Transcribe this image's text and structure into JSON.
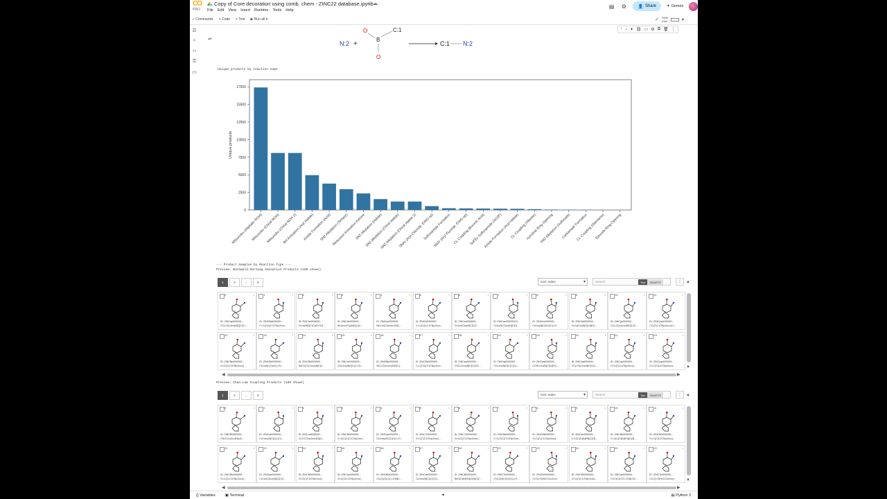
{
  "header": {
    "logo_text": "CO",
    "pro_text": "PRO",
    "title": "Copy of Core decoration using comb. chem - ZINC22 database.ipynb",
    "menus": [
      "File",
      "Edit",
      "View",
      "Insert",
      "Runtime",
      "Tools",
      "Help"
    ],
    "share_label": "Share",
    "gemini_label": "Gemini"
  },
  "toolbar": {
    "commands_label": "Commands",
    "code_label": "+ Code",
    "text_label": "+ Text",
    "run_all_label": "Run all",
    "ram_label": "RAM",
    "disk_label": "Disk"
  },
  "reaction": {
    "left_n": "N:2",
    "plus": "+",
    "o_top": "O",
    "c1_top": "C:1",
    "b": "B",
    "o_bottom": "O",
    "prod_c": "C:1",
    "prod_n": "N:2"
  },
  "text": {
    "chart_caption": "Unique products by reaction name",
    "samples_header": "--- Product Samples by Reaction Type ---",
    "preview1": "Preview: Buchwald-Hartwig Amination Products (100 shown)",
    "preview2": "Preview: Chan-Lam Coupling Products (100 shown)"
  },
  "chart_data": {
    "type": "bar",
    "ylabel": "Unique products",
    "xlabel": "",
    "ylim": [
      0,
      18500
    ],
    "yticks": [
      0,
      2500,
      5000,
      7500,
      10000,
      12500,
      15000,
      17500
    ],
    "color": "#3274a1",
    "categories": [
      "Mitsunobu (Aliphatic ROH)",
      "Mitsunobu (Chiral ROH)",
      "Mitsunobu (Chiral ROH 2)",
      "BH Amination (Aryl Halide)",
      "Amide Formation (Acid)",
      "SN2 Alkylation (Tertiary)",
      "Reductive Amination Ketone",
      "SN2 Alkylation (Halide)",
      "SN2 Alkylation (Chiral Halide)",
      "SN2 Alkylation (Chiral Halide 2)",
      "SNAr (Aryl Chloride, EWG-sp)",
      "Sulfonamide Formation",
      "SNAr (Aryl Fluoride, EWG-sp)",
      "CL Coupling (Boronic Acid)",
      "SuFEx Sulfonamide (SO2F)",
      "Amide Formation (Acyl Halide)",
      "CL Coupling (Silanes)",
      "Aziridine Ring Opening",
      "SN2 Alkylation (Sulfonate)",
      "Carbamate Formation",
      "CL Coupling (Stannane)",
      "Epoxide Ring Opening"
    ],
    "values": [
      17400,
      8100,
      8100,
      4950,
      3750,
      2950,
      2350,
      1550,
      1200,
      1200,
      550,
      250,
      230,
      210,
      190,
      170,
      120,
      60,
      50,
      30,
      20,
      10
    ]
  },
  "grid1": {
    "pages": [
      "1",
      "2",
      "...",
      "5"
    ],
    "sort_label": "Sort: Index",
    "search_placeholder": "Search",
    "toggle_text": "Text",
    "toggle_smarts": "SMARTS",
    "cards": [
      {
        "n": "0",
        "t1": "ID: ZINCapl000001...",
        "t2": "CC(=O)c1cc(N[C]C(C=..."
      },
      {
        "n": "1",
        "t1": "ID: ZINCBbl000000...",
        "t2": "C=C(C)C(C1CN(c2ccc..."
      },
      {
        "n": "2",
        "t1": "ID: ZINCaeI000000...",
        "t2": "Cc1c(N[C]C(C)c2=O(1..."
      },
      {
        "n": "3",
        "t1": "ID: ZINCbkI000000...",
        "t2": "Nc1ncccF)c(N[C]C(C..."
      },
      {
        "n": "4",
        "t1": "ID: ZINCaoI000000...",
        "t2": "NCc1c(Cl)ccc(c1N(C..."
      },
      {
        "n": "5",
        "t1": "ID: ZINCb0000000...",
        "t2": "C=C(C)C(C1CN(c2ccc..."
      },
      {
        "n": "6",
        "t1": "ID: ZINCsaI000000...",
        "t2": "Cc1cc(Cl)c(N[C]C(C..."
      },
      {
        "n": "7",
        "t1": "ID: ZINCaeI00000024",
        "t2": "Cc1c(NCC)cc(N[C]C(..."
      },
      {
        "n": "8",
        "t1": "ID: ZINCboI000000...",
        "t2": "Cc1cc(N[C]C(C)C(=O..."
      },
      {
        "n": "9",
        "t1": "ID: ZINCb6I000000...",
        "t2": "Cc1c(C)c(N[C]C@H(..."
      },
      {
        "n": "10",
        "t1": "ID: ZINC(pl000000...",
        "t2": "CC(=O)c1ccc(N[C]C(C..."
      },
      {
        "n": "11",
        "t1": "ID: ZINC(aeI000000...",
        "t2": "CC(C)C1CN(c2ccc(C=..."
      },
      {
        "n": "12",
        "t1": "ID: ZINCBpI000000...",
        "t2": "O=C(C)C1CN(c2ccc(..."
      },
      {
        "n": "13",
        "t1": "ID: ZINCBkI000000...",
        "t2": "Cc1c(NCC)c(C(=O)..."
      },
      {
        "n": "14",
        "t1": "ID: ZINCBhI000000...",
        "t2": "N#CC(C)c1ccc(N[C]C..."
      },
      {
        "n": "15",
        "t1": "ID: ZINCaGI000000...",
        "t2": "COc1cc(N[C]C(C=O)..."
      },
      {
        "n": "16",
        "t1": "ID: ZINCBkI000000...",
        "t2": "NC(=O)c1ccc(N[C]C(..."
      },
      {
        "n": "17",
        "t1": "ID: ZINCBpI000000...",
        "t2": "C=C(C)C(C1CN(c2ccc..."
      },
      {
        "n": "18",
        "t1": "ID: ZINCapI000000...",
        "t2": "CSCc1ccc(N[C]C(C)C..."
      },
      {
        "n": "19",
        "t1": "ID: ZINCapI000000...",
        "t2": "CCc1cc(N[C]C(C)C(=..."
      },
      {
        "n": "20",
        "t1": "ID: ZINCaaI000000...",
        "t2": "CCNCc1c(N[C]C@H(..."
      },
      {
        "n": "21",
        "t1": "ID: ZINCaaI000000...",
        "t2": "CC(=O)c1cc(N[C]C(C..."
      },
      {
        "n": "22",
        "t1": "ID: ZINCapI000000...",
        "t2": "O=C(C)C1CN(c2ccc(..."
      },
      {
        "n": "23",
        "t1": "ID: ZINC(apI000000...",
        "t2": "O=C(C)C1CN(c2ccc(..."
      }
    ]
  },
  "grid2": {
    "pages": [
      "1",
      "2",
      "...",
      "5"
    ],
    "sort_label": "Sort: Index",
    "search_placeholder": "Search",
    "toggle_text": "Text",
    "toggle_smarts": "SMARTS",
    "cards": [
      {
        "n": "0",
        "t1": "ID: ZINCB0000000...",
        "t2": "CN1CC(c2cc(N)c(C..."
      },
      {
        "n": "1",
        "t1": "ID: ZINCaeI000000...",
        "t2": "Cc1ncc(N[C]C(C)C(..."
      },
      {
        "n": "2",
        "t1": "ID: ZINCaaI000000...",
        "t2": "CC1CCN(c2ccc(N[C]..."
      },
      {
        "n": "3",
        "t1": "ID: ZINCB0000000...",
        "t2": "C=C(C)C(C1CN(c2ccc..."
      },
      {
        "n": "4",
        "t1": "ID: ZINCaeI000000...",
        "t2": "Cc1ncc(NC(C)C(C=O..."
      },
      {
        "n": "5",
        "t1": "ID: ZINC7U000000...",
        "t2": "O=C(C)C1CN(c2ccc(..."
      },
      {
        "n": "6",
        "t1": "ID: ZINC750000000...",
        "t2": "O=C(C)C1CN(c2ccc(..."
      },
      {
        "n": "7",
        "t1": "ID: ZINCBkI000000...",
        "t2": "C=C(C)C(C1CN(c2ccc..."
      },
      {
        "n": "8",
        "t1": "ID: ZINCBkI000000...",
        "t2": "O=C(C)C1CN(c2ccc(..."
      },
      {
        "n": "9",
        "t1": "ID: ZINCaeI000000...",
        "t2": "C=C(C[C@@H](C)N[..."
      },
      {
        "n": "10",
        "t1": "ID: ZINCBkI000000...",
        "t2": "C=C(C[C@@H](C)N[..."
      },
      {
        "n": "11",
        "t1": "ID: ZINCB0I000000...",
        "t2": "O=C(C)C1CN(c2ccc(..."
      },
      {
        "n": "12",
        "t1": "ID: ZINCBkI000000...",
        "t2": "O=C(C)C1CN(c2ccc(..."
      },
      {
        "n": "13",
        "t1": "ID: ZINCaeI000000...",
        "t2": "Cc1cc(C)ccc(N[C]C(C..."
      },
      {
        "n": "14",
        "t1": "ID: ZINCB0I000000...",
        "t2": "O=C(C)C1CN(c2ccc(..."
      },
      {
        "n": "15",
        "t1": "ID: ZINCaeI000000...",
        "t2": "O=C(C)C1CN(c2ccc(..."
      },
      {
        "n": "16",
        "t1": "ID: ZINCBkI000000...",
        "t2": "CC(C)(C)C(C=O)N[C..."
      },
      {
        "n": "17",
        "t1": "ID: ZINCaeI000000...",
        "t2": "Cc1ncc(N[C]C(C)C(..."
      },
      {
        "n": "18",
        "t1": "ID: ZINCB0I000000...",
        "t2": "N#C[C@@H](C)N[C]C..."
      },
      {
        "n": "19",
        "t1": "ID: ZINC7kI000000...",
        "t2": "CC(C)N(C)C(C)C(=O..."
      },
      {
        "n": "20",
        "t1": "ID: ZINCB0I000000...",
        "t2": "CCC(=O)N1CC(c2ccc..."
      },
      {
        "n": "21",
        "t1": "ID: ZINCB0I000000...",
        "t2": "O=C(C)C1CN(c2ccc(..."
      },
      {
        "n": "22",
        "t1": "ID: ZINCaeI000000...",
        "t2": "CCC(C)CCC=O)N(C)C..."
      },
      {
        "n": "23",
        "t1": "ID: ZINC7kI000000...",
        "t2": "CCC(=O)N1CC(c2ccc..."
      }
    ]
  },
  "footer": {
    "variables_label": "Variables",
    "terminal_label": "Terminal",
    "runtime_label": "Python 3"
  }
}
